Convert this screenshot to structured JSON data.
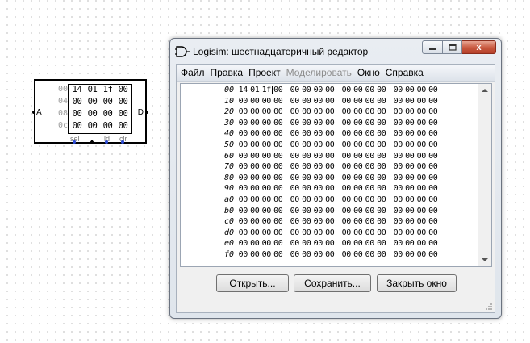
{
  "ram": {
    "addresses": [
      "00",
      "04",
      "08",
      "0c"
    ],
    "rows": [
      [
        "14",
        "01",
        "1f",
        "00"
      ],
      [
        "00",
        "00",
        "00",
        "00"
      ],
      [
        "00",
        "00",
        "00",
        "00"
      ],
      [
        "00",
        "00",
        "00",
        "00"
      ]
    ],
    "pin_a": "A",
    "pin_d": "D",
    "bottom_labels": [
      "sel",
      "ld",
      "clr"
    ]
  },
  "window": {
    "title": "Logisim: шестнадцатеричный редактор",
    "controls": {
      "close_glyph": "x"
    }
  },
  "menu": [
    "Файл",
    "Правка",
    "Проект",
    "Моделировать",
    "Окно",
    "Справка"
  ],
  "hex_editor": {
    "rows": [
      {
        "addr": "00",
        "bytes": [
          "14",
          "01",
          "1f",
          "00",
          "00",
          "00",
          "00",
          "00",
          "00",
          "00",
          "00",
          "00",
          "00",
          "00",
          "00",
          "00"
        ]
      },
      {
        "addr": "10",
        "bytes": [
          "00",
          "00",
          "00",
          "00",
          "00",
          "00",
          "00",
          "00",
          "00",
          "00",
          "00",
          "00",
          "00",
          "00",
          "00",
          "00"
        ]
      },
      {
        "addr": "20",
        "bytes": [
          "00",
          "00",
          "00",
          "00",
          "00",
          "00",
          "00",
          "00",
          "00",
          "00",
          "00",
          "00",
          "00",
          "00",
          "00",
          "00"
        ]
      },
      {
        "addr": "30",
        "bytes": [
          "00",
          "00",
          "00",
          "00",
          "00",
          "00",
          "00",
          "00",
          "00",
          "00",
          "00",
          "00",
          "00",
          "00",
          "00",
          "00"
        ]
      },
      {
        "addr": "40",
        "bytes": [
          "00",
          "00",
          "00",
          "00",
          "00",
          "00",
          "00",
          "00",
          "00",
          "00",
          "00",
          "00",
          "00",
          "00",
          "00",
          "00"
        ]
      },
      {
        "addr": "50",
        "bytes": [
          "00",
          "00",
          "00",
          "00",
          "00",
          "00",
          "00",
          "00",
          "00",
          "00",
          "00",
          "00",
          "00",
          "00",
          "00",
          "00"
        ]
      },
      {
        "addr": "60",
        "bytes": [
          "00",
          "00",
          "00",
          "00",
          "00",
          "00",
          "00",
          "00",
          "00",
          "00",
          "00",
          "00",
          "00",
          "00",
          "00",
          "00"
        ]
      },
      {
        "addr": "70",
        "bytes": [
          "00",
          "00",
          "00",
          "00",
          "00",
          "00",
          "00",
          "00",
          "00",
          "00",
          "00",
          "00",
          "00",
          "00",
          "00",
          "00"
        ]
      },
      {
        "addr": "80",
        "bytes": [
          "00",
          "00",
          "00",
          "00",
          "00",
          "00",
          "00",
          "00",
          "00",
          "00",
          "00",
          "00",
          "00",
          "00",
          "00",
          "00"
        ]
      },
      {
        "addr": "90",
        "bytes": [
          "00",
          "00",
          "00",
          "00",
          "00",
          "00",
          "00",
          "00",
          "00",
          "00",
          "00",
          "00",
          "00",
          "00",
          "00",
          "00"
        ]
      },
      {
        "addr": "a0",
        "bytes": [
          "00",
          "00",
          "00",
          "00",
          "00",
          "00",
          "00",
          "00",
          "00",
          "00",
          "00",
          "00",
          "00",
          "00",
          "00",
          "00"
        ]
      },
      {
        "addr": "b0",
        "bytes": [
          "00",
          "00",
          "00",
          "00",
          "00",
          "00",
          "00",
          "00",
          "00",
          "00",
          "00",
          "00",
          "00",
          "00",
          "00",
          "00"
        ]
      },
      {
        "addr": "c0",
        "bytes": [
          "00",
          "00",
          "00",
          "00",
          "00",
          "00",
          "00",
          "00",
          "00",
          "00",
          "00",
          "00",
          "00",
          "00",
          "00",
          "00"
        ]
      },
      {
        "addr": "d0",
        "bytes": [
          "00",
          "00",
          "00",
          "00",
          "00",
          "00",
          "00",
          "00",
          "00",
          "00",
          "00",
          "00",
          "00",
          "00",
          "00",
          "00"
        ]
      },
      {
        "addr": "e0",
        "bytes": [
          "00",
          "00",
          "00",
          "00",
          "00",
          "00",
          "00",
          "00",
          "00",
          "00",
          "00",
          "00",
          "00",
          "00",
          "00",
          "00"
        ]
      },
      {
        "addr": "f0",
        "bytes": [
          "00",
          "00",
          "00",
          "00",
          "00",
          "00",
          "00",
          "00",
          "00",
          "00",
          "00",
          "00",
          "00",
          "00",
          "00",
          "00"
        ]
      }
    ],
    "cursor": {
      "row": 0,
      "col": 2
    }
  },
  "buttons": {
    "open": "Открыть...",
    "save": "Сохранить...",
    "close_window": "Закрыть окно"
  },
  "icons": {
    "app": "logisim-gate-icon",
    "minimize": "minimize-icon",
    "maximize": "maximize-icon",
    "close": "close-icon"
  },
  "colors": {
    "close_button": "#c8583f",
    "pin_blue": "#2c4bd6"
  }
}
